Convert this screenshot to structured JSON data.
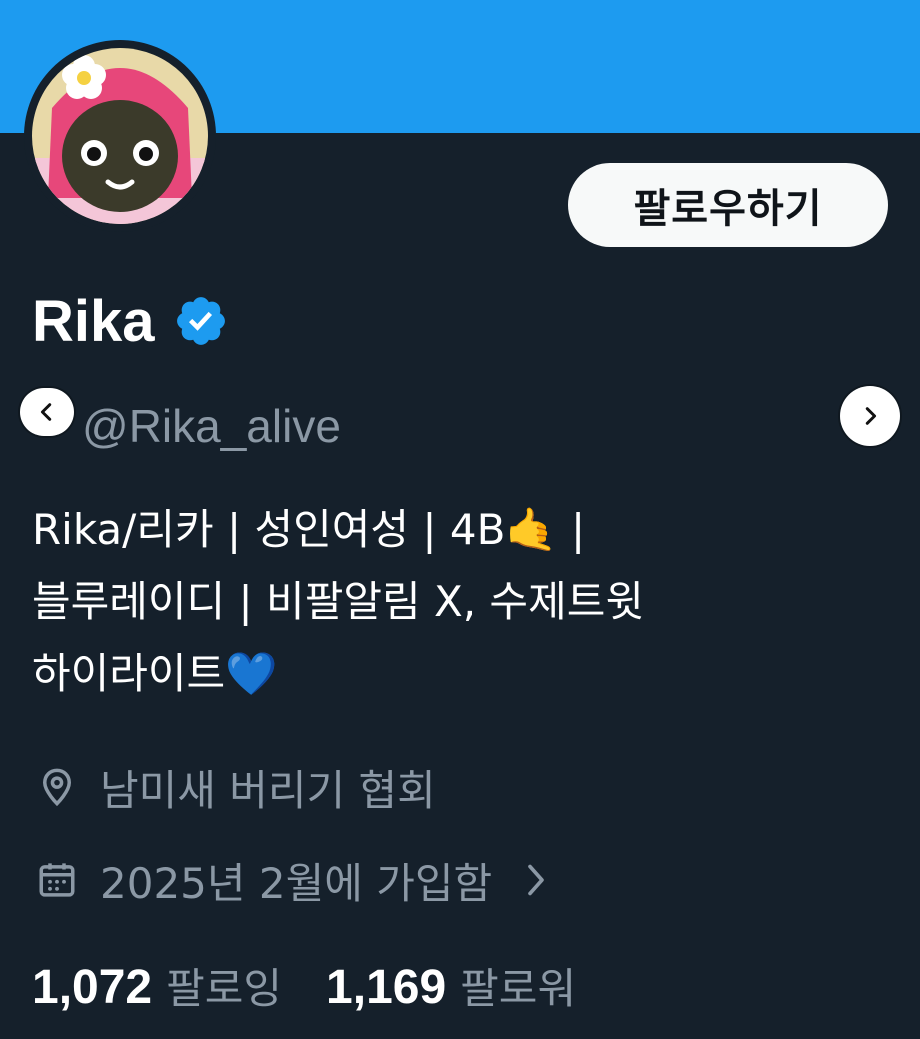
{
  "profile": {
    "display_name": "Rika",
    "handle": "@Rika_alive",
    "verified": true,
    "follow_button_label": "팔로우하기",
    "bio_lines": [
      "Rika/리카 | 성인여성 | 4B🤙 |",
      "블루레이디 | 비팔알림 X, 수제트윗",
      "하이라이트💙"
    ],
    "location": "남미새 버리기 협회",
    "joined": "2025년 2월에 가입함",
    "stats": {
      "following_count": "1,072",
      "following_label": "팔로잉",
      "followers_count": "1,169",
      "followers_label": "팔로워"
    }
  },
  "icons": {
    "verified_badge": "verified-badge-icon",
    "location": "location-pin-icon",
    "calendar": "calendar-icon",
    "nav_prev": "chevron-left-icon",
    "nav_next": "chevron-right-icon",
    "joined_chevron": "chevron-right-icon"
  },
  "colors": {
    "banner": "#1d9bf0",
    "background": "#15202b",
    "muted_text": "#8b98a5",
    "verified": "#1d9bf0",
    "follow_button_bg": "#f7f9f9"
  }
}
